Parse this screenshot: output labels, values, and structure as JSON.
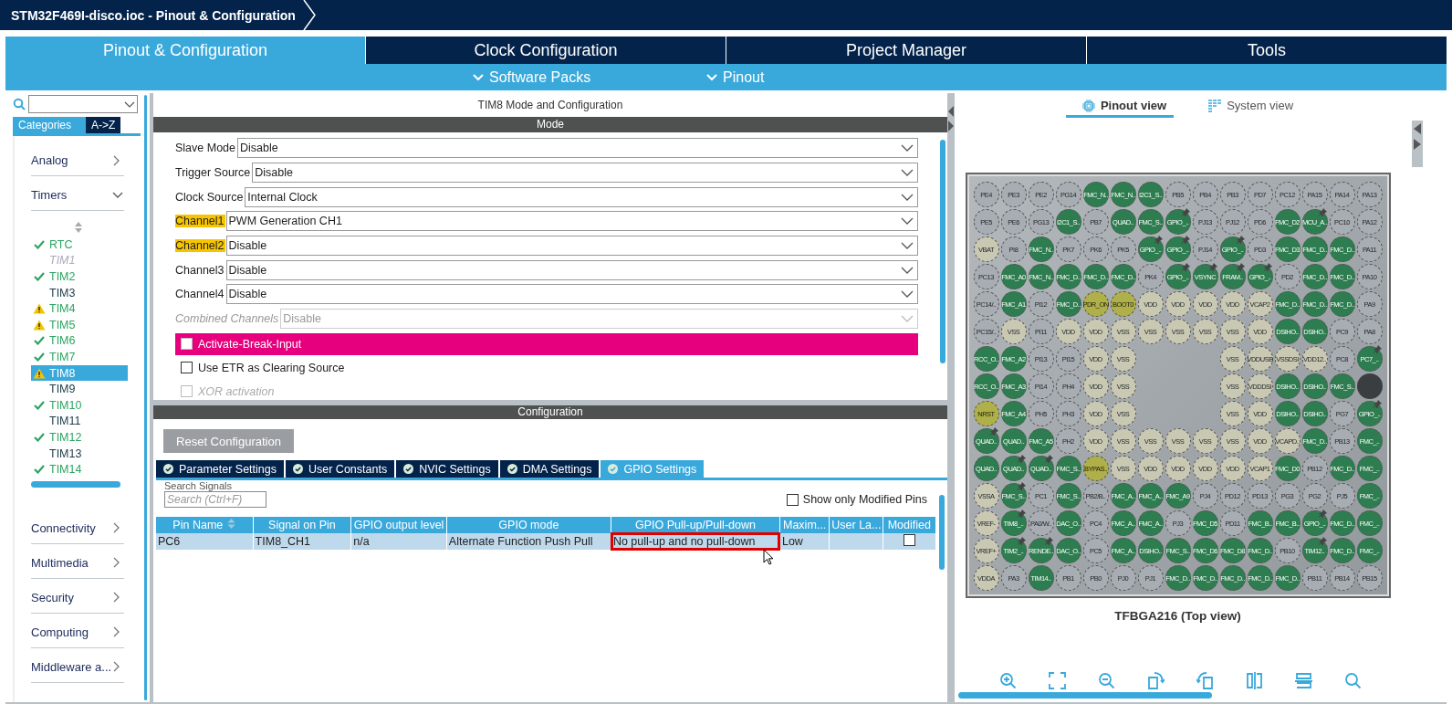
{
  "window": {
    "title": "STM32F469I-disco.ioc - Pinout & Configuration"
  },
  "main_tabs": [
    {
      "label": "Pinout & Configuration",
      "selected": true
    },
    {
      "label": "Clock Configuration",
      "selected": false
    },
    {
      "label": "Project Manager",
      "selected": false
    },
    {
      "label": "Tools",
      "selected": false
    }
  ],
  "sub_menus": [
    {
      "label": "Software Packs"
    },
    {
      "label": "Pinout"
    }
  ],
  "sidebar": {
    "view_tabs": [
      {
        "label": "Categories",
        "selected": true
      },
      {
        "label": "A->Z",
        "selected": false
      }
    ],
    "categories": [
      {
        "label": "Analog",
        "expanded": false
      },
      {
        "label": "Timers",
        "expanded": true,
        "children": [
          {
            "label": "RTC",
            "kind": "ok",
            "selected": false
          },
          {
            "label": "TIM1",
            "kind": "disabled",
            "selected": false
          },
          {
            "label": "TIM2",
            "kind": "ok",
            "selected": false
          },
          {
            "label": "TIM3",
            "kind": "plain",
            "selected": false
          },
          {
            "label": "TIM4",
            "kind": "warning",
            "selected": false
          },
          {
            "label": "TIM5",
            "kind": "warning",
            "selected": false
          },
          {
            "label": "TIM6",
            "kind": "ok",
            "selected": false
          },
          {
            "label": "TIM7",
            "kind": "ok",
            "selected": false
          },
          {
            "label": "TIM8",
            "kind": "warning",
            "selected": true
          },
          {
            "label": "TIM9",
            "kind": "plain",
            "selected": false
          },
          {
            "label": "TIM10",
            "kind": "ok",
            "selected": false
          },
          {
            "label": "TIM11",
            "kind": "plain",
            "selected": false
          },
          {
            "label": "TIM12",
            "kind": "ok",
            "selected": false
          },
          {
            "label": "TIM13",
            "kind": "plain",
            "selected": false
          },
          {
            "label": "TIM14",
            "kind": "ok",
            "selected": false
          }
        ]
      },
      {
        "label": "Connectivity",
        "expanded": false
      },
      {
        "label": "Multimedia",
        "expanded": false
      },
      {
        "label": "Security",
        "expanded": false
      },
      {
        "label": "Computing",
        "expanded": false
      },
      {
        "label": "Middleware a...",
        "expanded": false
      }
    ]
  },
  "mode_panel": {
    "title": "TIM8 Mode and Configuration",
    "section": "Mode",
    "fields": [
      {
        "label": "Slave Mode",
        "value": "Disable",
        "highlighted": false,
        "disabled": false
      },
      {
        "label": "Trigger Source",
        "value": "Disable",
        "highlighted": false,
        "disabled": false
      },
      {
        "label": "Clock Source",
        "value": "Internal Clock",
        "highlighted": false,
        "disabled": false
      },
      {
        "label": "Channel1",
        "value": "PWM Generation CH1",
        "highlighted": true,
        "disabled": false
      },
      {
        "label": "Channel2",
        "value": "Disable",
        "highlighted": true,
        "disabled": false
      },
      {
        "label": "Channel3",
        "value": "Disable",
        "highlighted": false,
        "disabled": false
      },
      {
        "label": "Channel4",
        "value": "Disable",
        "highlighted": false,
        "disabled": false
      },
      {
        "label": "Combined Channels",
        "value": "Disable",
        "highlighted": false,
        "disabled": true
      }
    ],
    "options": [
      {
        "label": "Activate-Break-Input",
        "checked": false,
        "highlighted": true,
        "disabled": false
      },
      {
        "label": "Use ETR as Clearing Source",
        "checked": false,
        "highlighted": false,
        "disabled": false
      },
      {
        "label": "XOR activation",
        "checked": false,
        "highlighted": false,
        "disabled": true
      }
    ]
  },
  "config_panel": {
    "section": "Configuration",
    "reset_button": "Reset Configuration",
    "tabs": [
      {
        "label": "Parameter Settings",
        "selected": false
      },
      {
        "label": "User Constants",
        "selected": false
      },
      {
        "label": "NVIC Settings",
        "selected": false
      },
      {
        "label": "DMA Settings",
        "selected": false
      },
      {
        "label": "GPIO Settings",
        "selected": true
      }
    ],
    "search_label": "Search Signals",
    "search": {
      "placeholder": "Search (Ctrl+F)"
    },
    "filter": {
      "label": "Show only Modified Pins",
      "checked": false
    },
    "table": {
      "columns": [
        "Pin Name",
        "Signal on Pin",
        "GPIO output level",
        "GPIO mode",
        "GPIO Pull-up/Pull-down",
        "Maxim...",
        "User La...",
        "Modified"
      ],
      "rows": [
        {
          "selected": true,
          "modified": false,
          "cells": [
            {
              "text": "PC6",
              "outlined": false
            },
            {
              "text": "TIM8_CH1",
              "outlined": false
            },
            {
              "text": "n/a",
              "outlined": false
            },
            {
              "text": "Alternate Function Push Pull",
              "outlined": false
            },
            {
              "text": "No pull-up and no pull-down",
              "outlined": true
            },
            {
              "text": "Low",
              "outlined": false
            },
            {
              "outlined": false
            }
          ]
        }
      ]
    }
  },
  "pinout": {
    "views": [
      {
        "label": "Pinout view",
        "selected": true,
        "kind": "chip"
      },
      {
        "label": "System view",
        "selected": false,
        "kind": "system"
      }
    ],
    "package": "TFBGA216 (Top view)",
    "pins": [
      [
        {
          "kind": "io",
          "label": "PE4"
        },
        {
          "kind": "io",
          "label": "PE3"
        },
        {
          "kind": "io",
          "label": "PE2"
        },
        {
          "kind": "io",
          "label": "PG14"
        },
        {
          "kind": "sig",
          "label": "FMC_N.."
        },
        {
          "kind": "sig",
          "label": "FMC_N.."
        },
        {
          "kind": "sig",
          "label": "I2C1_S.."
        },
        {
          "kind": "io",
          "label": "PB5"
        },
        {
          "kind": "io",
          "label": "PB4"
        },
        {
          "kind": "io",
          "label": "PB3"
        },
        {
          "kind": "io",
          "label": "PD7"
        },
        {
          "kind": "io",
          "label": "PC12"
        },
        {
          "kind": "io",
          "label": "PA15"
        },
        {
          "kind": "io",
          "label": "PA14"
        },
        {
          "kind": "io",
          "label": "PA13"
        }
      ],
      [
        {
          "kind": "io",
          "label": "PE5"
        },
        {
          "kind": "io",
          "label": "PE6"
        },
        {
          "kind": "io",
          "label": "PG13"
        },
        {
          "kind": "sig",
          "label": "I2C1_S.."
        },
        {
          "kind": "io",
          "label": "PB7"
        },
        {
          "kind": "sig",
          "label": "QUAD.."
        },
        {
          "kind": "sig",
          "label": "FMC_S.."
        },
        {
          "kind": "locked",
          "label": "GPIO_.."
        },
        {
          "kind": "io",
          "label": "PJ13"
        },
        {
          "kind": "io",
          "label": "PJ12"
        },
        {
          "kind": "io",
          "label": "PD6"
        },
        {
          "kind": "sig",
          "label": "FMC_D2"
        },
        {
          "kind": "locked",
          "label": "MCU_A.."
        },
        {
          "kind": "io",
          "label": "PC10"
        },
        {
          "kind": "io",
          "label": "PA12"
        }
      ],
      [
        {
          "kind": "pwr",
          "label": "VBAT"
        },
        {
          "kind": "io",
          "label": "PI8"
        },
        {
          "kind": "sig",
          "label": "FMC_N.."
        },
        {
          "kind": "io",
          "label": "PK7"
        },
        {
          "kind": "io",
          "label": "PK6"
        },
        {
          "kind": "io",
          "label": "PK5"
        },
        {
          "kind": "locked",
          "label": "GPIO_.."
        },
        {
          "kind": "locked",
          "label": "GPIO_.."
        },
        {
          "kind": "io",
          "label": "PJ14"
        },
        {
          "kind": "locked",
          "label": "GPIO_.."
        },
        {
          "kind": "io",
          "label": "PD3"
        },
        {
          "kind": "sig",
          "label": "FMC_D3"
        },
        {
          "kind": "sig",
          "label": "FMC_D.."
        },
        {
          "kind": "sig",
          "label": "FMC_D.."
        },
        {
          "kind": "io",
          "label": "PA11"
        }
      ],
      [
        {
          "kind": "io",
          "label": "PC13"
        },
        {
          "kind": "sig",
          "label": "FMC_A0"
        },
        {
          "kind": "sig",
          "label": "FMC_N.."
        },
        {
          "kind": "sig",
          "label": "FMC_D.."
        },
        {
          "kind": "sig",
          "label": "FMC_D.."
        },
        {
          "kind": "sig",
          "label": "FMC_D.."
        },
        {
          "kind": "io",
          "label": "PK4"
        },
        {
          "kind": "locked",
          "label": "GPIO_.."
        },
        {
          "kind": "locked",
          "label": "VSYNC"
        },
        {
          "kind": "locked",
          "label": "FRAM.."
        },
        {
          "kind": "locked",
          "label": "GPIO_.."
        },
        {
          "kind": "io",
          "label": "PD2"
        },
        {
          "kind": "sig",
          "label": "FMC_D.."
        },
        {
          "kind": "sig",
          "label": "FMC_D.."
        },
        {
          "kind": "io",
          "label": "PA10"
        }
      ],
      [
        {
          "kind": "io",
          "label": "PC14/.."
        },
        {
          "kind": "sig",
          "label": "FMC_A1"
        },
        {
          "kind": "io",
          "label": "PI12"
        },
        {
          "kind": "sig",
          "label": "FMC_D.."
        },
        {
          "kind": "sys",
          "label": "PDR_ON"
        },
        {
          "kind": "sys",
          "label": "BOOT0"
        },
        {
          "kind": "pwr",
          "label": "VDD"
        },
        {
          "kind": "pwr",
          "label": "VDD"
        },
        {
          "kind": "pwr",
          "label": "VDD"
        },
        {
          "kind": "pwr",
          "label": "VDD"
        },
        {
          "kind": "pwr",
          "label": "VCAP2"
        },
        {
          "kind": "sig",
          "label": "FMC_D.."
        },
        {
          "kind": "sig",
          "label": "FMC_D.."
        },
        {
          "kind": "sig",
          "label": "FMC_D.."
        },
        {
          "kind": "io",
          "label": "PA9"
        }
      ],
      [
        {
          "kind": "io",
          "label": "PC15/.."
        },
        {
          "kind": "pwr",
          "label": "VSS"
        },
        {
          "kind": "io",
          "label": "PI11"
        },
        {
          "kind": "pwr",
          "label": "VDD"
        },
        {
          "kind": "pwr",
          "label": "VDD"
        },
        {
          "kind": "pwr",
          "label": "VSS"
        },
        {
          "kind": "pwr",
          "label": "VSS"
        },
        {
          "kind": "pwr",
          "label": "VSS"
        },
        {
          "kind": "pwr",
          "label": "VSS"
        },
        {
          "kind": "pwr",
          "label": "VSS"
        },
        {
          "kind": "pwr",
          "label": "VDD"
        },
        {
          "kind": "sig",
          "label": "DSIHO.."
        },
        {
          "kind": "sig",
          "label": "DSIHO.."
        },
        {
          "kind": "io",
          "label": "PC9"
        },
        {
          "kind": "io",
          "label": "PA8"
        }
      ],
      [
        {
          "kind": "sig",
          "label": "RCC_O.."
        },
        {
          "kind": "sig",
          "label": "FMC_A2"
        },
        {
          "kind": "io",
          "label": "PI13"
        },
        {
          "kind": "io",
          "label": "PI15"
        },
        {
          "kind": "pwr",
          "label": "VDD"
        },
        {
          "kind": "pwr",
          "label": "VSS"
        },
        {
          "kind": "none"
        },
        {
          "kind": "none"
        },
        {
          "kind": "none"
        },
        {
          "kind": "pwr",
          "label": "VSS"
        },
        {
          "kind": "pwr",
          "label": "VDDUSB"
        },
        {
          "kind": "pwr",
          "label": "VSSDSI"
        },
        {
          "kind": "pwr",
          "label": "VDD12.."
        },
        {
          "kind": "io",
          "label": "PC8"
        },
        {
          "kind": "locked",
          "label": "PC7_.."
        }
      ],
      [
        {
          "kind": "sig",
          "label": "RCC_O.."
        },
        {
          "kind": "sig",
          "label": "FMC_A3"
        },
        {
          "kind": "io",
          "label": "PI14"
        },
        {
          "kind": "io",
          "label": "PH4"
        },
        {
          "kind": "pwr",
          "label": "VDD"
        },
        {
          "kind": "pwr",
          "label": "VSS"
        },
        {
          "kind": "none"
        },
        {
          "kind": "none"
        },
        {
          "kind": "none"
        },
        {
          "kind": "pwr",
          "label": "VSS"
        },
        {
          "kind": "pwr",
          "label": "VDDDSI"
        },
        {
          "kind": "sig",
          "label": "DSIHO.."
        },
        {
          "kind": "sig",
          "label": "DSIHO.."
        },
        {
          "kind": "sig",
          "label": "FMC_S.."
        },
        {
          "kind": "selected"
        }
      ],
      [
        {
          "kind": "sys",
          "label": "NRST"
        },
        {
          "kind": "sig",
          "label": "FMC_A4"
        },
        {
          "kind": "io",
          "label": "PH5"
        },
        {
          "kind": "io",
          "label": "PH3"
        },
        {
          "kind": "pwr",
          "label": "VDD"
        },
        {
          "kind": "pwr",
          "label": "VSS"
        },
        {
          "kind": "none"
        },
        {
          "kind": "none"
        },
        {
          "kind": "none"
        },
        {
          "kind": "pwr",
          "label": "VSS"
        },
        {
          "kind": "pwr",
          "label": "VDD"
        },
        {
          "kind": "sig",
          "label": "DSIHO.."
        },
        {
          "kind": "sig",
          "label": "DSIHO.."
        },
        {
          "kind": "io",
          "label": "PG7"
        },
        {
          "kind": "locked",
          "label": "GPIO_.."
        }
      ],
      [
        {
          "kind": "locked",
          "label": "QUAD.."
        },
        {
          "kind": "sig",
          "label": "QUAD.."
        },
        {
          "kind": "sig",
          "label": "FMC_A5"
        },
        {
          "kind": "io",
          "label": "PH2"
        },
        {
          "kind": "pwr",
          "label": "VDD"
        },
        {
          "kind": "pwr",
          "label": "VSS"
        },
        {
          "kind": "pwr",
          "label": "VSS"
        },
        {
          "kind": "pwr",
          "label": "VSS"
        },
        {
          "kind": "pwr",
          "label": "VSS"
        },
        {
          "kind": "pwr",
          "label": "VSS"
        },
        {
          "kind": "pwr",
          "label": "VDD"
        },
        {
          "kind": "pwr",
          "label": "VCAPD.."
        },
        {
          "kind": "sig",
          "label": "FMC_D.."
        },
        {
          "kind": "io",
          "label": "PB13"
        },
        {
          "kind": "sig",
          "label": "FMC_.."
        }
      ],
      [
        {
          "kind": "sig",
          "label": "QUAD.."
        },
        {
          "kind": "locked",
          "label": "QUAD.."
        },
        {
          "kind": "locked",
          "label": "QUAD.."
        },
        {
          "kind": "sig",
          "label": "FMC_S.."
        },
        {
          "kind": "sys",
          "label": "BYPAS.."
        },
        {
          "kind": "pwr",
          "label": "VSS"
        },
        {
          "kind": "pwr",
          "label": "VDD"
        },
        {
          "kind": "pwr",
          "label": "VDD"
        },
        {
          "kind": "pwr",
          "label": "VDD"
        },
        {
          "kind": "pwr",
          "label": "VDD"
        },
        {
          "kind": "pwr",
          "label": "VCAP1"
        },
        {
          "kind": "sig",
          "label": "FMC_D0"
        },
        {
          "kind": "io",
          "label": "PB12"
        },
        {
          "kind": "sig",
          "label": "FMC_D.."
        },
        {
          "kind": "sig",
          "label": "FMC_.."
        }
      ],
      [
        {
          "kind": "pwr",
          "label": "VSSA"
        },
        {
          "kind": "locked",
          "label": "FMC_S.."
        },
        {
          "kind": "io",
          "label": "PC1"
        },
        {
          "kind": "sig",
          "label": "FMC_S.."
        },
        {
          "kind": "io",
          "label": "PB2/B.."
        },
        {
          "kind": "sig",
          "label": "FMC_A.."
        },
        {
          "kind": "sig",
          "label": "FMC_A.."
        },
        {
          "kind": "sig",
          "label": "FMC_A9"
        },
        {
          "kind": "io",
          "label": "PJ4"
        },
        {
          "kind": "io",
          "label": "PD12"
        },
        {
          "kind": "io",
          "label": "PD13"
        },
        {
          "kind": "io",
          "label": "PG3"
        },
        {
          "kind": "io",
          "label": "PG2"
        },
        {
          "kind": "io",
          "label": "PJ5"
        },
        {
          "kind": "sig",
          "label": "FMC_.."
        }
      ],
      [
        {
          "kind": "pwr",
          "label": "VREF-"
        },
        {
          "kind": "locked",
          "label": "TIM8_.."
        },
        {
          "kind": "io",
          "label": "PA0/W.."
        },
        {
          "kind": "sig",
          "label": "DAC_O.."
        },
        {
          "kind": "io",
          "label": "PC4"
        },
        {
          "kind": "sig",
          "label": "FMC_A.."
        },
        {
          "kind": "sig",
          "label": "FMC_A.."
        },
        {
          "kind": "io",
          "label": "PJ3"
        },
        {
          "kind": "sig",
          "label": "FMC_D5"
        },
        {
          "kind": "io",
          "label": "PD11"
        },
        {
          "kind": "sig",
          "label": "FMC_B.."
        },
        {
          "kind": "sig",
          "label": "FMC_B.."
        },
        {
          "kind": "locked",
          "label": "GPIO_.."
        },
        {
          "kind": "sig",
          "label": "FMC_D.."
        },
        {
          "kind": "sig",
          "label": "FMC_.."
        }
      ],
      [
        {
          "kind": "pwr",
          "label": "VREF+"
        },
        {
          "kind": "locked",
          "label": "TIM2_.."
        },
        {
          "kind": "locked",
          "label": "RENDE.."
        },
        {
          "kind": "sig",
          "label": "DAC_O.."
        },
        {
          "kind": "io",
          "label": "PC5"
        },
        {
          "kind": "sig",
          "label": "FMC_A.."
        },
        {
          "kind": "sig",
          "label": "DSIHO.."
        },
        {
          "kind": "sig",
          "label": "FMC_S.."
        },
        {
          "kind": "sig",
          "label": "FMC_D6"
        },
        {
          "kind": "sig",
          "label": "FMC_D8"
        },
        {
          "kind": "sig",
          "label": "FMC_D.."
        },
        {
          "kind": "io",
          "label": "PB10"
        },
        {
          "kind": "locked",
          "label": "TIM12.."
        },
        {
          "kind": "sig",
          "label": "FMC_D.."
        },
        {
          "kind": "sig",
          "label": "FMC_.."
        }
      ],
      [
        {
          "kind": "pwr",
          "label": "VDDA"
        },
        {
          "kind": "io",
          "label": "PA3"
        },
        {
          "kind": "sig",
          "label": "TIM14.."
        },
        {
          "kind": "io",
          "label": "PB1"
        },
        {
          "kind": "io",
          "label": "PB0"
        },
        {
          "kind": "io",
          "label": "PJ0"
        },
        {
          "kind": "io",
          "label": "PJ1"
        },
        {
          "kind": "sig",
          "label": "FMC_D.."
        },
        {
          "kind": "sig",
          "label": "FMC_D.."
        },
        {
          "kind": "sig",
          "label": "FMC_D.."
        },
        {
          "kind": "sig",
          "label": "FMC_D.."
        },
        {
          "kind": "sig",
          "label": "FMC_D.."
        },
        {
          "kind": "io",
          "label": "PB11"
        },
        {
          "kind": "io",
          "label": "PB14"
        },
        {
          "kind": "io",
          "label": "PB15"
        }
      ]
    ]
  }
}
